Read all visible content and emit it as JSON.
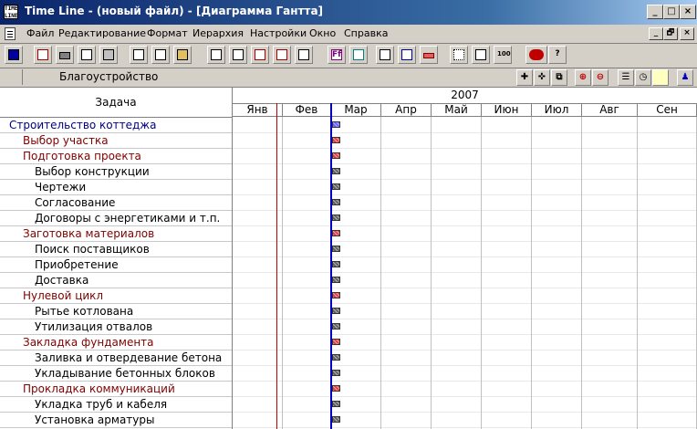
{
  "window": {
    "title": "Time Line - (новый файл) - [Диаграмма Гантта]",
    "app_icon_text": "TIME LINE",
    "controls": [
      "_",
      "□",
      "×"
    ],
    "mdi_controls": [
      "_",
      "🗗",
      "×"
    ]
  },
  "menu": {
    "items": [
      "Файл",
      "Редактирование",
      "Формат",
      "Иерархия",
      "Настройки",
      "Окно",
      "Справка"
    ]
  },
  "toolbar": {
    "buttons": [
      "new-chart-icon",
      "new-doc-icon",
      "printer-icon",
      "copy-icon",
      "calendar-icon",
      "cut-icon",
      "paste-icon",
      "clipboard-icon",
      "outline-list-icon",
      "outline-list2-icon",
      "indent-icon",
      "outdent-icon",
      "sort-icon",
      "font-icon",
      "highlight-icon",
      "tree-icon",
      "link-icon",
      "bar-style-icon",
      "grid-icon",
      "split-icon",
      "zoom100-icon",
      "mascot-icon",
      "help-icon"
    ],
    "labels": {
      "font": "Ff",
      "zoom": "100"
    }
  },
  "subbar": {
    "current_task": "Благоустройство",
    "tools": [
      "add-task-icon",
      "add-milestone-icon",
      "link-tasks-icon",
      "zoom-in-icon",
      "zoom-out-icon",
      "list-icon",
      "clock-icon",
      "note-icon",
      "person-icon"
    ]
  },
  "grid": {
    "task_header": "Задача",
    "year": "2007",
    "months": [
      "Янв",
      "Фев",
      "Мар",
      "Апр",
      "Май",
      "Июн",
      "Июл",
      "Авг",
      "Сен"
    ],
    "tasks": [
      {
        "name": "Строительство коттеджа",
        "level": 0,
        "type": "project"
      },
      {
        "name": "Выбор участка",
        "level": 1,
        "type": "summary"
      },
      {
        "name": "Подготовка проекта",
        "level": 1,
        "type": "summary"
      },
      {
        "name": "Выбор конструкции",
        "level": 2,
        "type": "task"
      },
      {
        "name": "Чертежи",
        "level": 2,
        "type": "task"
      },
      {
        "name": "Согласование",
        "level": 2,
        "type": "task"
      },
      {
        "name": "Договоры с энергетиками и т.п.",
        "level": 2,
        "type": "task"
      },
      {
        "name": "Заготовка материалов",
        "level": 1,
        "type": "summary"
      },
      {
        "name": "Поиск поставщиков",
        "level": 2,
        "type": "task"
      },
      {
        "name": "Приобретение",
        "level": 2,
        "type": "task"
      },
      {
        "name": "Доставка",
        "level": 2,
        "type": "task"
      },
      {
        "name": "Нулевой цикл",
        "level": 1,
        "type": "summary"
      },
      {
        "name": "Рытье котлована",
        "level": 2,
        "type": "task"
      },
      {
        "name": "Утилизация отвалов",
        "level": 2,
        "type": "task"
      },
      {
        "name": "Закладка фундамента",
        "level": 1,
        "type": "summary"
      },
      {
        "name": "Заливка и отвердевание бетона",
        "level": 2,
        "type": "task"
      },
      {
        "name": "Укладывание бетонных блоков",
        "level": 2,
        "type": "task"
      },
      {
        "name": "Прокладка коммуникаций",
        "level": 1,
        "type": "summary"
      },
      {
        "name": "Укладка труб и кабеля",
        "level": 2,
        "type": "task"
      },
      {
        "name": "Установка арматуры",
        "level": 2,
        "type": "task"
      }
    ]
  },
  "colors": {
    "project_text": "#000080",
    "summary_text": "#800000",
    "task_text": "#000000",
    "project_bar": "#6060ff",
    "summary_bar": "#e04040",
    "task_bar": "#606060",
    "today_line": "#c00000",
    "plan_line": "#0000c0"
  }
}
